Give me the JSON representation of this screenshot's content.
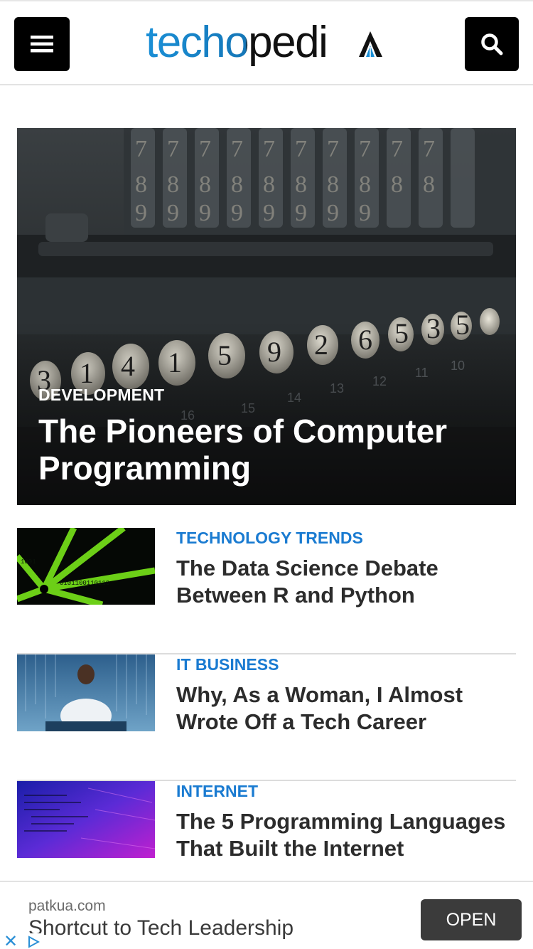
{
  "header": {
    "menu_icon": "hamburger-menu-icon",
    "search_icon": "search-icon",
    "logo": {
      "text_main": "techopedi",
      "text_end": "A",
      "primary_color": "#1a8fd6",
      "dark_color": "#111111"
    }
  },
  "featured": {
    "category": "DEVELOPMENT",
    "title": "The Pioneers of Computer Programming"
  },
  "articles": [
    {
      "category": "TECHNOLOGY TRENDS",
      "title": "The Data Science Debate Between R and Python"
    },
    {
      "category": "IT BUSINESS",
      "title": "Why, As a Woman, I Almost Wrote Off a Tech Career"
    },
    {
      "category": "INTERNET",
      "title": "The 5 Programming Languages That Built the Internet"
    }
  ],
  "ad": {
    "domain": "patkua.com",
    "headline": "Shortcut to Tech Leadership",
    "button": "OPEN",
    "close_icon": "close-icon",
    "adchoices_icon": "ad-choices-icon"
  },
  "colors": {
    "category_blue": "#1a7bd1",
    "title_dark": "#2c2c2c",
    "header_button": "#000000"
  }
}
